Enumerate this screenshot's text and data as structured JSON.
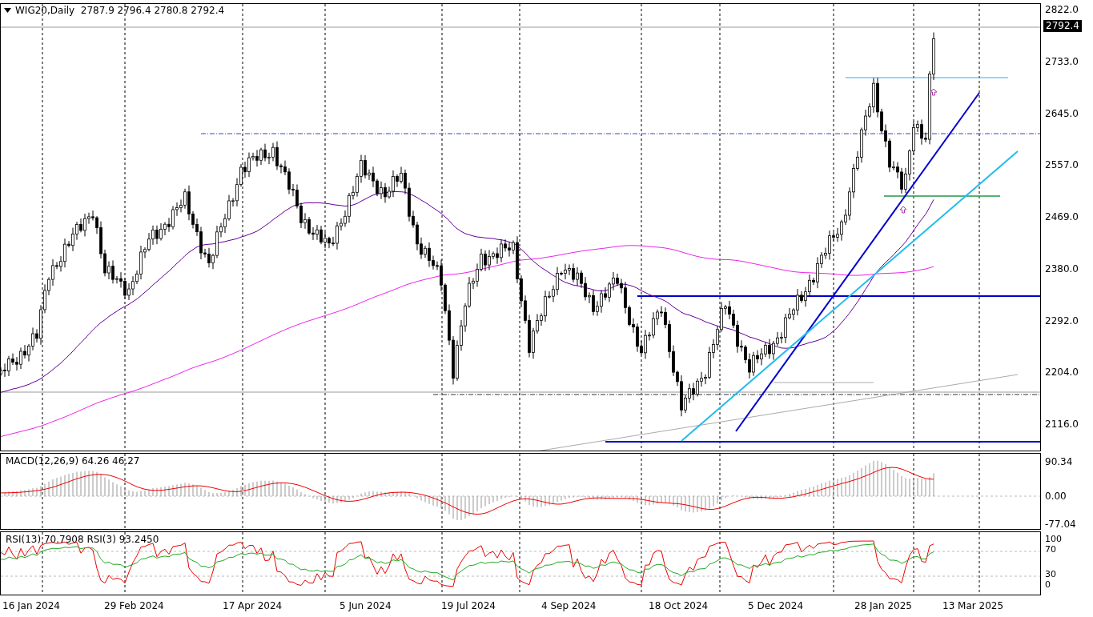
{
  "header": {
    "title": "WIG20,Daily  2787.9 2796.4 2780.8 2792.4"
  },
  "price_axis": {
    "labels": [
      "2822.0",
      "2733.0",
      "2645.0",
      "2557.0",
      "2469.0",
      "2380.0",
      "2292.0",
      "2204.0",
      "2116.0"
    ],
    "current_price": "2792.4"
  },
  "macd": {
    "label": "MACD(12,26,9) 64.26 46.27",
    "axis": [
      "90.34",
      "0.00",
      "-77.04"
    ]
  },
  "rsi": {
    "label": "RSI(13) 70.7908 RSI(3) 93.2450",
    "axis": [
      "100",
      "70",
      "30",
      "0"
    ]
  },
  "time_axis": [
    "16 Jan 2024",
    "29 Feb 2024",
    "17 Apr 2024",
    "5 Jun 2024",
    "19 Jul 2024",
    "4 Sep 2024",
    "18 Oct 2024",
    "5 Dec 2024",
    "28 Jan 2025",
    "13 Mar 2025"
  ]
}
